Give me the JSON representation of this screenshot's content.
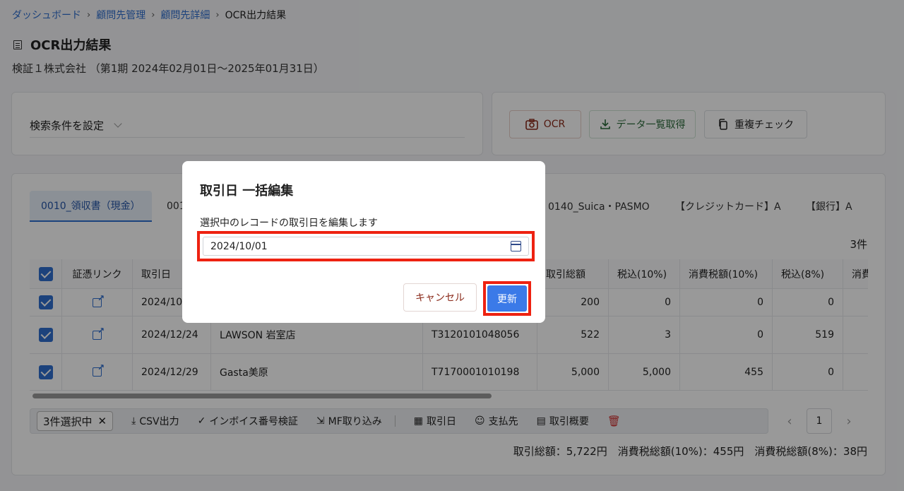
{
  "breadcrumb": {
    "items": [
      "ダッシュボード",
      "顧問先管理",
      "顧問先詳細"
    ],
    "current": "OCR出力結果",
    "separator": "›"
  },
  "page": {
    "title": "OCR出力結果",
    "subtitle": "検証１株式会社 （第1期 2024年02月01日～2025年01月31日）"
  },
  "search": {
    "label": "検索条件を設定"
  },
  "actions": {
    "ocr_label": "OCR",
    "data_export_label": "データ一覧取得",
    "dup_check_label": "重複チェック"
  },
  "tabs": [
    {
      "label": "0010_領収書（現金）",
      "active": true
    },
    {
      "label": "001"
    },
    {
      "label": "0140_Suica・PASMO"
    },
    {
      "label": "【クレジットカード】A"
    },
    {
      "label": "【銀行】A"
    }
  ],
  "table": {
    "count_label": "3件",
    "columns": [
      "証憑リンク",
      "取引日",
      "",
      "",
      "取引総額",
      "税込(10%)",
      "消費税額(10%)",
      "税込(8%)",
      "消費"
    ],
    "rows": [
      {
        "date": "2024/10/",
        "vendor": "",
        "invoice": "",
        "total": "200",
        "tax10_incl": "0",
        "tax10": "0",
        "tax8_incl": "0"
      },
      {
        "date": "2024/12/24",
        "vendor": "LAWSON 岩室店",
        "invoice": "T3120101048056",
        "total": "522",
        "tax10_incl": "3",
        "tax10": "0",
        "tax8_incl": "519"
      },
      {
        "date": "2024/12/29",
        "vendor": "Gasta美原",
        "invoice": "T7170001010198",
        "total": "5,000",
        "tax10_incl": "5,000",
        "tax10": "455",
        "tax8_incl": "0"
      }
    ]
  },
  "bulk_bar": {
    "selected_label": "3件選択中",
    "csv": "CSV出力",
    "invoice_check": "インボイス番号検証",
    "mf_import": "MF取り込み",
    "date": "取引日",
    "payee": "支払先",
    "summary": "取引概要"
  },
  "pager": {
    "page": "1"
  },
  "totals": {
    "text": "取引総額：5,722円　消費税総額(10%)：455円　消費税総額(8%)：38円"
  },
  "modal": {
    "title": "取引日 一括編集",
    "description": "選択中のレコードの取引日を編集します",
    "date_value": "2024/10/01",
    "cancel_label": "キャンセル",
    "update_label": "更新"
  },
  "colors": {
    "accent": "#2f6fcf",
    "highlight": "#ee2211",
    "primary_button": "#3b7ae8"
  }
}
